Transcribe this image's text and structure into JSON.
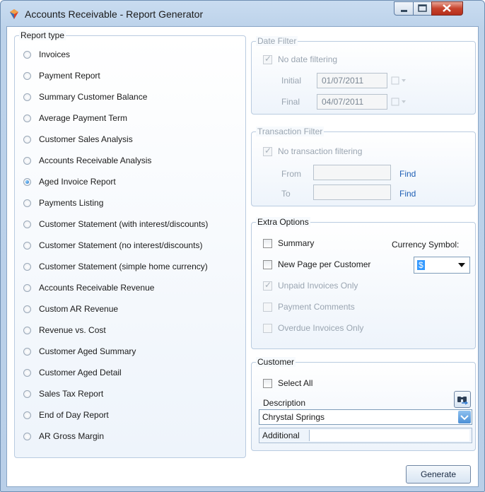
{
  "window": {
    "title": "Accounts Receivable - Report Generator"
  },
  "report_type": {
    "legend": "Report type",
    "options": [
      "Invoices",
      "Payment Report",
      "Summary Customer Balance",
      "Average Payment Term",
      "Customer Sales Analysis",
      "Accounts Receivable Analysis",
      "Aged Invoice Report",
      "Payments Listing",
      "Customer Statement (with interest/discounts)",
      "Customer Statement (no interest/discounts)",
      "Customer Statement (simple home currency)",
      "Accounts Receivable Revenue",
      "Custom AR Revenue",
      "Revenue vs. Cost",
      "Customer Aged Summary",
      "Customer Aged Detail",
      "Sales Tax Report",
      "End of Day Report",
      "AR Gross Margin"
    ],
    "selected": "Aged Invoice Report"
  },
  "date_filter": {
    "legend": "Date Filter",
    "no_date_label": "No date filtering",
    "initial_label": "Initial",
    "initial_value": "01/07/2011",
    "final_label": "Final",
    "final_value": "04/07/2011"
  },
  "transaction_filter": {
    "legend": "Transaction Filter",
    "no_transaction_label": "No transaction filtering",
    "from_label": "From",
    "to_label": "To",
    "find_label": "Find"
  },
  "extra_options": {
    "legend": "Extra Options",
    "summary_label": "Summary",
    "new_page_label": "New Page per Customer",
    "unpaid_label": "Unpaid Invoices Only",
    "payment_comments_label": "Payment Comments",
    "overdue_label": "Overdue Invoices Only",
    "currency_label": "Currency Symbol:",
    "currency_value": "$"
  },
  "customer": {
    "legend": "Customer",
    "select_all_label": "Select All",
    "description_label": "Description",
    "description_value": "Chrystal Springs",
    "additional_label": "Additional"
  },
  "actions": {
    "generate_label": "Generate"
  },
  "colors": {
    "accent": "#1f5fb5",
    "close_button": "#c7432d"
  }
}
